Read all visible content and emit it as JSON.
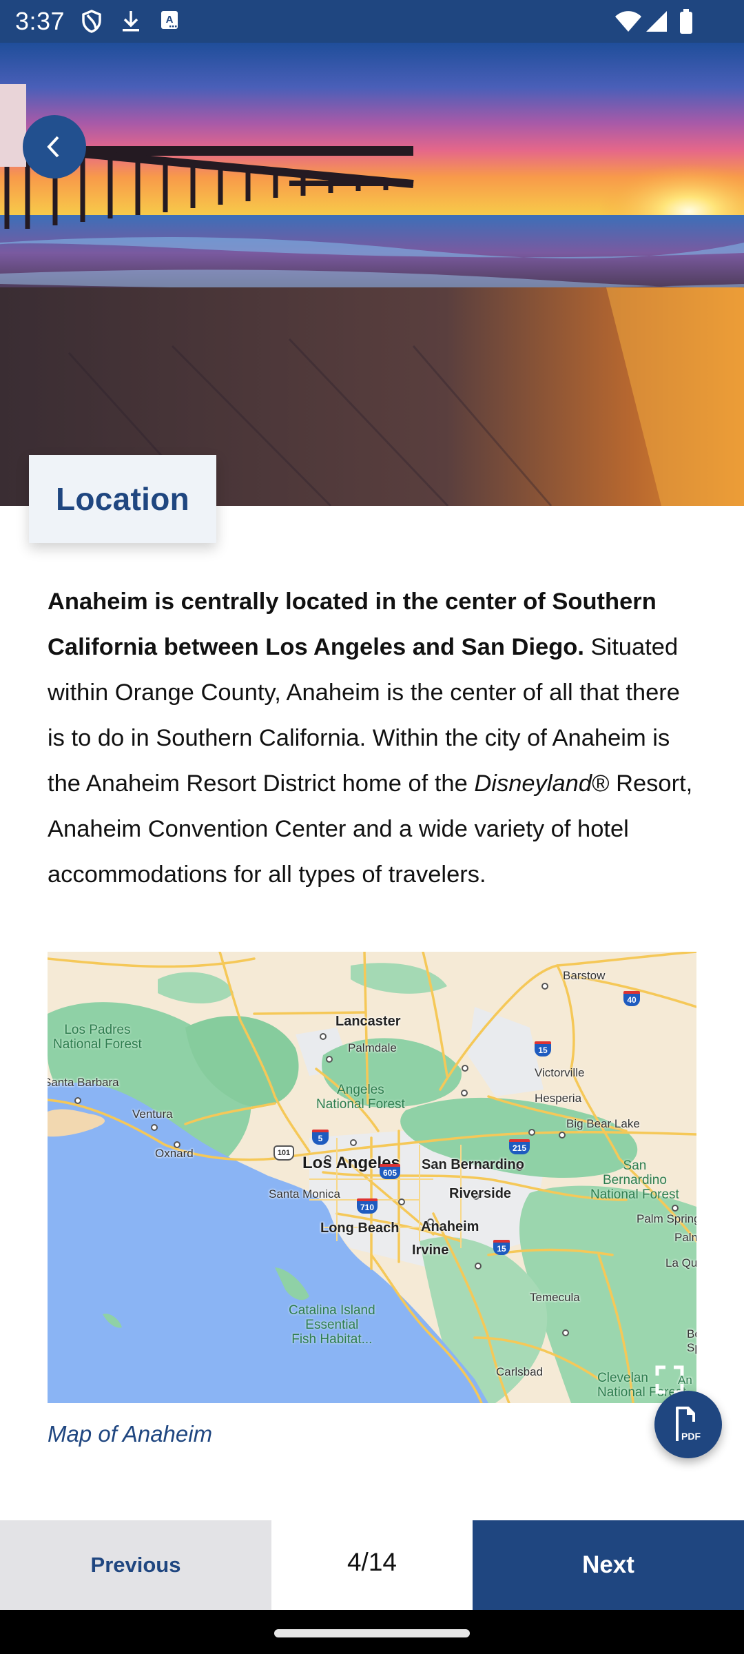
{
  "status_bar": {
    "time": "3:37",
    "left_icons": [
      "shield-icon",
      "download-icon",
      "accessibility-text-icon"
    ],
    "right_icons": [
      "wifi-icon",
      "cell-signal-icon",
      "battery-icon"
    ],
    "color": "#1f4680"
  },
  "hero": {
    "image": "Pier at sunset over the ocean",
    "back_button_icon": "chevron-left-icon"
  },
  "section": {
    "title": "Location"
  },
  "article": {
    "bold_lead": "Anaheim is centrally located in the center of Southern California between Los Angeles and San Diego.",
    "text_1": " Situated within Orange County, Anaheim is the center of all that there is to do in Southern California. Within the city of Anaheim is the Anaheim Resort District home of the ",
    "italic": "Disneyland",
    "text_2": "® Resort, Anaheim Convention Center and a wide variety of hotel accommodations for all types of travelers."
  },
  "map": {
    "caption": "Map of Anaheim",
    "major_cities": [
      "Los Angeles",
      "Lancaster",
      "Anaheim",
      "Long Beach",
      "Riverside",
      "Irvine",
      "San Bernardino"
    ],
    "cities": [
      "Barstow",
      "Palmdale",
      "Victorville",
      "Hesperia",
      "Big Bear Lake",
      "Santa Barbara",
      "Ventura",
      "Oxnard",
      "Santa Monica",
      "Temecula",
      "Carlsbad",
      "Palm Springs",
      "Palm",
      "La Qu",
      "Bo Sp",
      "An"
    ],
    "parks": [
      "Los Padres\nNational Forest",
      "Angeles\nNational Forest",
      "San\nBernardino\nNational Forest",
      "Catalina Island\nEssential\nFish Habitat...",
      "Clevelan\nNational Forest"
    ],
    "highway_shields": {
      "interstate": [
        "5",
        "15",
        "40",
        "215",
        "605",
        "710",
        "15"
      ],
      "us_route": [
        "101"
      ]
    },
    "fullscreen_icon": "fullscreen-icon"
  },
  "fab": {
    "icon": "pdf-icon",
    "label": "PDF"
  },
  "pager": {
    "previous_label": "Previous",
    "current_page": 4,
    "total_pages": 14,
    "indicator": "4/14",
    "next_label": "Next"
  }
}
